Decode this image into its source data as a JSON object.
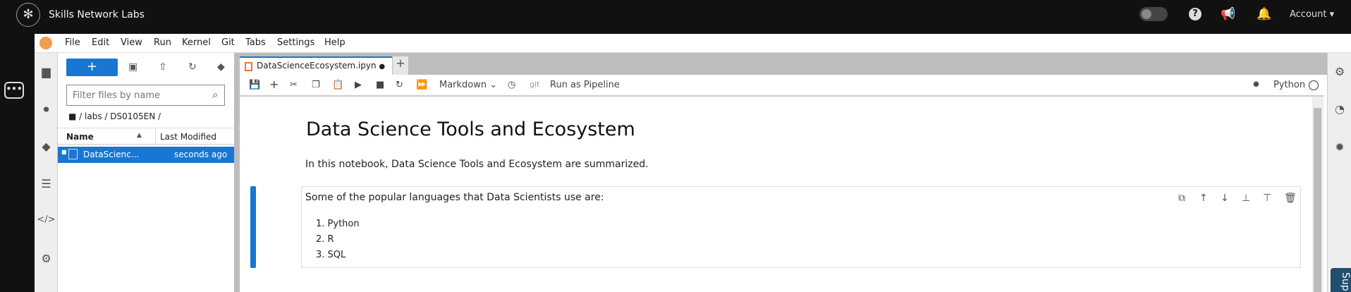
{
  "header": {
    "brand": "Skills Network Labs",
    "account": "Account",
    "icons": [
      "moon-icon",
      "help-icon",
      "megaphone-icon",
      "bell-icon"
    ]
  },
  "menu": [
    "File",
    "Edit",
    "View",
    "Run",
    "Kernel",
    "Git",
    "Tabs",
    "Settings",
    "Help"
  ],
  "filebrowser": {
    "new_label": "+",
    "filter_placeholder": "Filter files by name",
    "breadcrumb": "/ labs / DS0105EN /",
    "col_name": "Name",
    "col_modified": "Last Modified",
    "files": [
      {
        "name": "DataScienc...",
        "modified": "seconds ago"
      }
    ]
  },
  "notebook": {
    "tab_title": "DataScienceEcosystem.ipyn",
    "cell_type": "Markdown",
    "git": "git",
    "pipeline": "Run as Pipeline",
    "kernel": "Python",
    "title": "Data Science Tools and Ecosystem",
    "intro": "In this notebook, Data Science Tools and Ecosystem are summarized.",
    "cell_text": "Some of the popular languages that Data Scientists use are:",
    "languages": [
      "1. Python",
      "2. R",
      "3. SQL"
    ]
  },
  "support_tab": "Sup",
  "colors": {
    "accent": "#1976d2",
    "topbar": "#111111"
  }
}
